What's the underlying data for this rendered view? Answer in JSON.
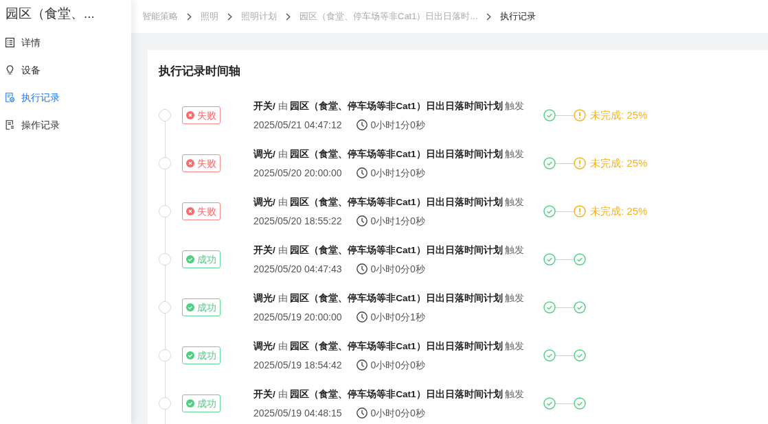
{
  "sidebar": {
    "title": "园区（食堂、...",
    "items": [
      {
        "label": "详情",
        "selected": false
      },
      {
        "label": "设备",
        "selected": false
      },
      {
        "label": "执行记录",
        "selected": true
      },
      {
        "label": "操作记录",
        "selected": false
      }
    ]
  },
  "breadcrumb": [
    {
      "label": "智能策略",
      "current": false
    },
    {
      "label": "照明",
      "current": false
    },
    {
      "label": "照明计划",
      "current": false
    },
    {
      "label": "园区（食堂、停车场等非Cat1）日出日落时...",
      "current": false
    },
    {
      "label": "执行记录",
      "current": true
    }
  ],
  "timeline": {
    "title": "执行记录时间轴",
    "records": [
      {
        "status": {
          "kind": "failure",
          "label": "失败"
        },
        "description": "**开关/** 由 **园区（食堂、停车场等非Cat1）日出日落时间计划** 触发",
        "time": "2025/05/21 04:47:12",
        "duration": "0小时1分0秒",
        "steps": [
          {
            "kind": "done"
          },
          {
            "kind": "warning",
            "label": "未完成: 25%"
          }
        ]
      },
      {
        "status": {
          "kind": "failure",
          "label": "失败"
        },
        "description": "**调光/** 由 **园区（食堂、停车场等非Cat1）日出日落时间计划** 触发",
        "time": "2025/05/20 20:00:00",
        "duration": "0小时1分0秒",
        "steps": [
          {
            "kind": "done"
          },
          {
            "kind": "warning",
            "label": "未完成: 25%"
          }
        ]
      },
      {
        "status": {
          "kind": "failure",
          "label": "失败"
        },
        "description": "**调光/** 由 **园区（食堂、停车场等非Cat1）日出日落时间计划** 触发",
        "time": "2025/05/20 18:55:22",
        "duration": "0小时1分0秒",
        "steps": [
          {
            "kind": "done"
          },
          {
            "kind": "warning",
            "label": "未完成: 25%"
          }
        ]
      },
      {
        "status": {
          "kind": "success",
          "label": "成功"
        },
        "description": "**开关/** 由 **园区（食堂、停车场等非Cat1）日出日落时间计划** 触发",
        "time": "2025/05/20 04:47:43",
        "duration": "0小时0分0秒",
        "steps": [
          {
            "kind": "done"
          },
          {
            "kind": "done"
          }
        ]
      },
      {
        "status": {
          "kind": "success",
          "label": "成功"
        },
        "description": "**调光/** 由 **园区（食堂、停车场等非Cat1）日出日落时间计划** 触发",
        "time": "2025/05/19 20:00:00",
        "duration": "0小时0分1秒",
        "steps": [
          {
            "kind": "done"
          },
          {
            "kind": "done"
          }
        ]
      },
      {
        "status": {
          "kind": "success",
          "label": "成功"
        },
        "description": "**调光/** 由 **园区（食堂、停车场等非Cat1）日出日落时间计划** 触发",
        "time": "2025/05/19 18:54:42",
        "duration": "0小时0分0秒",
        "steps": [
          {
            "kind": "done"
          },
          {
            "kind": "done"
          }
        ]
      },
      {
        "status": {
          "kind": "success",
          "label": "成功"
        },
        "description": "**开关/** 由 **园区（食堂、停车场等非Cat1）日出日落时间计划** 触发",
        "time": "2025/05/19 04:48:15",
        "duration": "0小时0分0秒",
        "steps": [
          {
            "kind": "done"
          },
          {
            "kind": "done"
          }
        ]
      }
    ]
  }
}
